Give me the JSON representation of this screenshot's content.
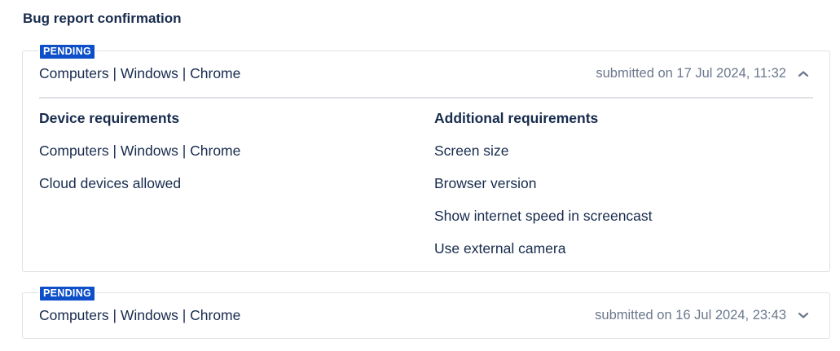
{
  "page": {
    "title": "Bug report confirmation"
  },
  "reports": [
    {
      "status": "PENDING",
      "title": "Computers | Windows | Chrome",
      "submitted": "submitted on 17 Jul 2024, 11:32",
      "expanded": true,
      "device_requirements": {
        "heading": "Device requirements",
        "items": [
          "Computers | Windows | Chrome",
          "Cloud devices allowed"
        ]
      },
      "additional_requirements": {
        "heading": "Additional requirements",
        "items": [
          "Screen size",
          "Browser version",
          "Show internet speed in screencast",
          "Use external camera"
        ]
      }
    },
    {
      "status": "PENDING",
      "title": "Computers | Windows | Chrome",
      "submitted": "submitted on 16 Jul 2024, 23:43",
      "expanded": false
    }
  ],
  "colors": {
    "badge_bg": "#0c4fc8",
    "text": "#172b4d",
    "muted": "#6b778c",
    "border": "#dfe1e6"
  },
  "icons": {
    "expanded": "chevron-up-icon",
    "collapsed": "chevron-down-icon"
  }
}
